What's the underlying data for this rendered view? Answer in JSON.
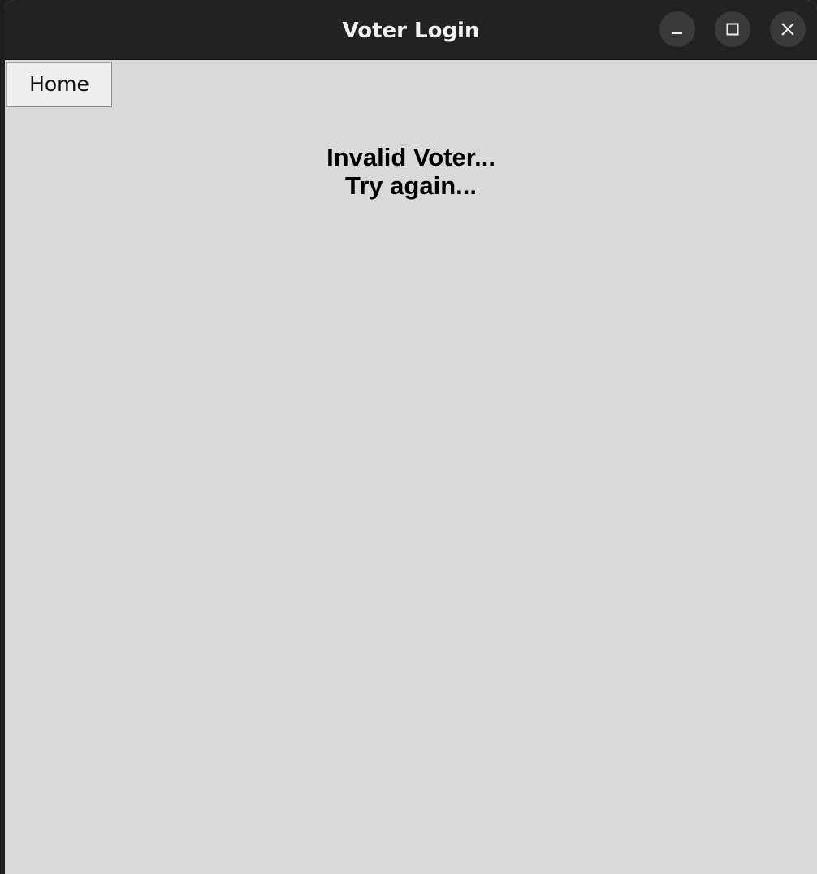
{
  "window": {
    "title": "Voter Login",
    "controls": {
      "minimize_icon": "minimize-icon",
      "maximize_icon": "maximize-icon",
      "close_icon": "close-icon"
    }
  },
  "main": {
    "home_label": "Home",
    "message_line1": "Invalid Voter...",
    "message_line2": "Try again..."
  },
  "colors": {
    "titlebar_bg": "#222222",
    "content_bg": "#d9d9d9",
    "button_bg": "#efefef"
  }
}
